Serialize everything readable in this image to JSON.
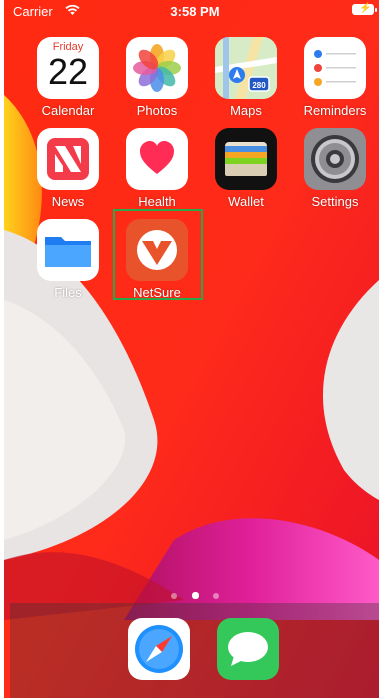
{
  "status_bar": {
    "carrier": "Carrier",
    "time": "3:58 PM"
  },
  "apps": {
    "calendar": {
      "label": "Calendar",
      "day": "Friday",
      "date": "22"
    },
    "photos": {
      "label": "Photos"
    },
    "maps": {
      "label": "Maps",
      "shield": "280"
    },
    "reminders": {
      "label": "Reminders"
    },
    "news": {
      "label": "News"
    },
    "health": {
      "label": "Health"
    },
    "wallet": {
      "label": "Wallet"
    },
    "settings": {
      "label": "Settings"
    },
    "files": {
      "label": "Files"
    },
    "netsure": {
      "label": "NetSure",
      "highlighted": true,
      "highlight_color": "#2aa84a"
    }
  },
  "page_indicator": {
    "pages": 3,
    "current": 2
  },
  "dock": [
    {
      "name": "safari",
      "icon": "compass-icon"
    },
    {
      "name": "messages",
      "icon": "speech-bubble-icon"
    }
  ]
}
